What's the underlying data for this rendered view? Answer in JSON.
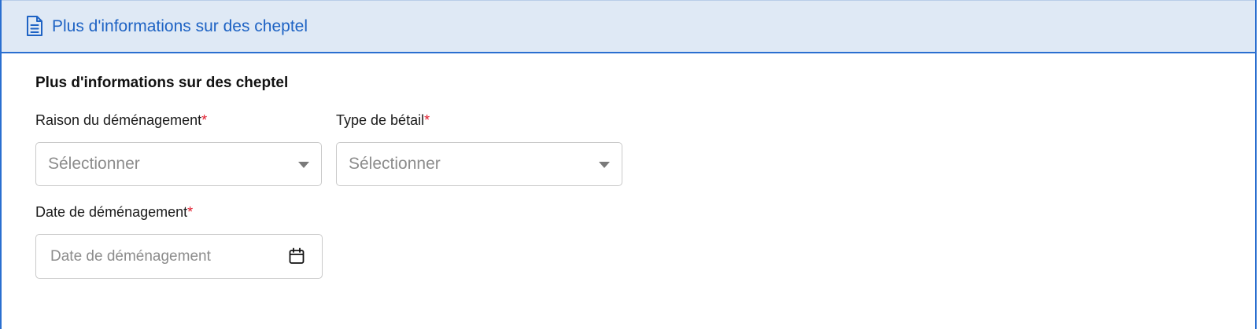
{
  "header": {
    "icon": "document-icon",
    "title": "Plus d'informations sur des cheptel"
  },
  "form": {
    "section_title": "Plus d'informations sur des cheptel",
    "required_marker": "*",
    "reason": {
      "label": "Raison du déménagement",
      "placeholder": "Sélectionner"
    },
    "livestock_type": {
      "label": "Type de bétail",
      "placeholder": "Sélectionner"
    },
    "move_date": {
      "label": "Date de déménagement",
      "placeholder": "Date de déménagement",
      "icon": "calendar-icon"
    }
  },
  "colors": {
    "accent": "#1e63c4",
    "header_bg": "#dfe9f5",
    "required": "#e01a2b"
  }
}
